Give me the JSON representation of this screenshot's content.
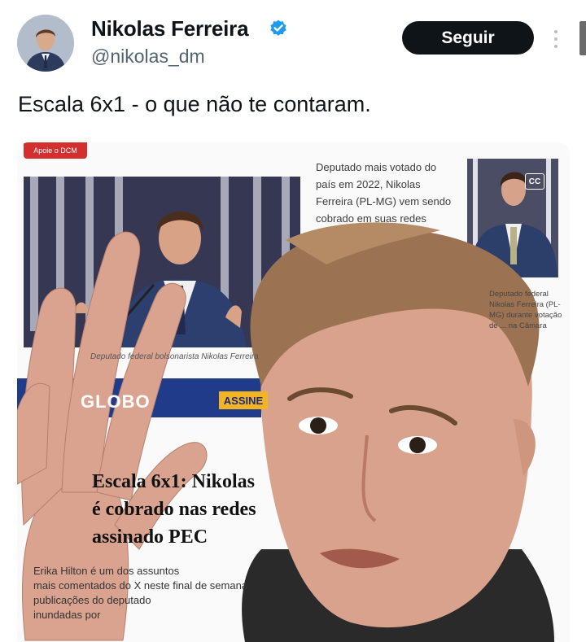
{
  "author": {
    "name": "Nikolas Ferreira",
    "handle": "@nikolas_dm",
    "verified": true,
    "avatar_icon": "profile-photo"
  },
  "actions": {
    "follow_label": "Seguir",
    "more_icon": "more-vertical-icon"
  },
  "tweet": {
    "text": "Escala 6x1 - o que não te contaram."
  },
  "media": {
    "badge": "Apoie o DCM",
    "side_text": "Deputado mais votado do país em 2022, Nikolas Ferreira (PL-MG) vem sendo cobrado em suas redes",
    "caption_left": "Deputado federal bolsonarista Nikolas Ferreira",
    "caption_right": "Deputado federal Nikolas Ferreira (PL-MG) durante votação de ... na Câmara",
    "logo_text": "GLOBO",
    "assine_label": "ASSINE",
    "headline_line1": "Escala 6x1: Nikolas",
    "headline_line2": "é cobrado nas redes",
    "headline_line3": "assinado PEC",
    "body_line1": "Erika Hilton é um dos assuntos",
    "body_line2": "mais comentados do X neste final de semana",
    "body_line3": "publicações do deputado",
    "body_line4": "inundadas por",
    "cc_label": "CC"
  },
  "colors": {
    "follow_bg": "#0f1419",
    "verified": "#1d9bf0",
    "handle": "#536471"
  }
}
